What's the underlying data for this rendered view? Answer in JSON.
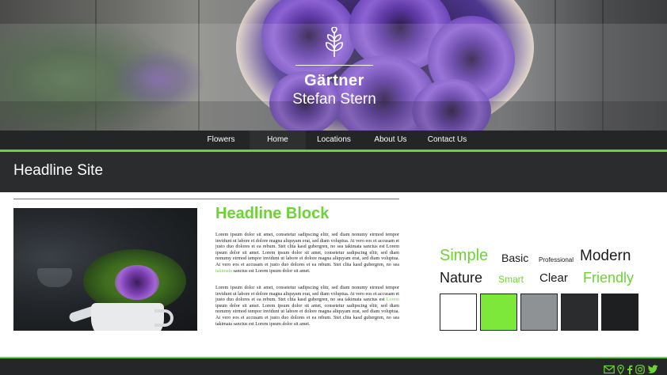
{
  "brand": {
    "name": "Gärtner",
    "owner": "Stefan Stern"
  },
  "nav": {
    "items": [
      {
        "label": "Flowers",
        "active": false
      },
      {
        "label": "Home",
        "active": true
      },
      {
        "label": "Locations",
        "active": false
      },
      {
        "label": "About Us",
        "active": false
      },
      {
        "label": "Contact Us",
        "active": false
      }
    ]
  },
  "page": {
    "headline": "Headline Site"
  },
  "content": {
    "block_title": "Headline Block",
    "paragraph1_a": "Lorem ipsum dolor sit amet, consetetur sadipscing elitr, sed diam nonumy eirmod tempor invidunt ut labore et dolore magna aliquyam erat, sed diam voluptua. At vero eos et accusam et justo duo dolores et ea rebum. Stet clita kasd gubergren, no sea takimata sanctus est Lorem ipsum dolor sit amet. Lorem ipsum dolor sit amet, consetetur sadipscing elitr, sed diam nonumy eirmod tempor invidunt ut labore et dolore magna aliquyam erat, sed diam voluptua. At vero eos et accusam et justo duo dolores et ea rebum. Stet clita kasd gubergren, no sea",
    "paragraph1_link": "takimata",
    "paragraph1_b": "sanctus est Lorem ipsum dolor sit amet.",
    "paragraph2_a": "Lorem ipsum dolor sit amet, consetetur sadipscing elitr, sed diam nonumy eirmod tempor invidunt ut labore et dolore magna aliquyam erat, sed diam voluptua. At vero eos et accusam et justo duo dolores et ea rebum. Stet clita kasd gubergren, no sea takimata sanctus est",
    "paragraph2_link": "Lorem",
    "paragraph2_b": "ipsum dolor sit amet. Lorem ipsum dolor sit amet, consetetur sadipscing elitr, sed diam nonumy eirmod tempor invidunt ut labore et dolore magna aliquyam erat, sed diam voluptua. At vero eos et accusam et justo duo dolores et ea rebum. Stet clita kasd gubergren, no sea takimata sanctus est Lorem ipsum dolor sit amet."
  },
  "style_words": {
    "simple": "Simple",
    "basic": "Basic",
    "professional": "Professional",
    "modern": "Modern",
    "nature": "Nature",
    "smart": "Smart",
    "clear": "Clear",
    "friendly": "Friendly"
  },
  "colors": {
    "accent_green": "#6cd432",
    "dark": "#2b2c2e",
    "swatches": [
      "#ffffff",
      "#7ee83a",
      "#8f9294",
      "#2b2c2e",
      "#1e1f21"
    ]
  },
  "footer": {
    "icons": [
      "mail-icon",
      "location-pin-icon",
      "facebook-icon",
      "instagram-icon",
      "twitter-icon"
    ]
  }
}
